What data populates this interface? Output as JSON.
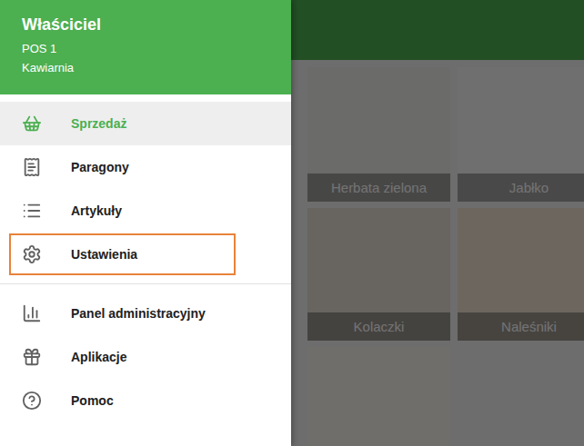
{
  "drawer": {
    "header": {
      "name": "Właściciel",
      "device": "POS 1",
      "venue": "Kawiarnia"
    },
    "groups": [
      {
        "items": [
          {
            "label": "Sprzedaż",
            "selected": true,
            "highlighted": false
          },
          {
            "label": "Paragony",
            "selected": false,
            "highlighted": false
          },
          {
            "label": "Artykuły",
            "selected": false,
            "highlighted": false
          },
          {
            "label": "Ustawienia",
            "selected": false,
            "highlighted": true
          }
        ]
      },
      {
        "items": [
          {
            "label": "Panel administracyjny",
            "selected": false,
            "highlighted": false
          },
          {
            "label": "Aplikacje",
            "selected": false,
            "highlighted": false
          },
          {
            "label": "Pomoc",
            "selected": false,
            "highlighted": false
          }
        ]
      }
    ]
  },
  "products": [
    {
      "label": "Herbata zielona"
    },
    {
      "label": "Jabłko"
    },
    {
      "label": "Kolaczki"
    },
    {
      "label": "Naleśniki"
    },
    {
      "label": ""
    }
  ]
}
